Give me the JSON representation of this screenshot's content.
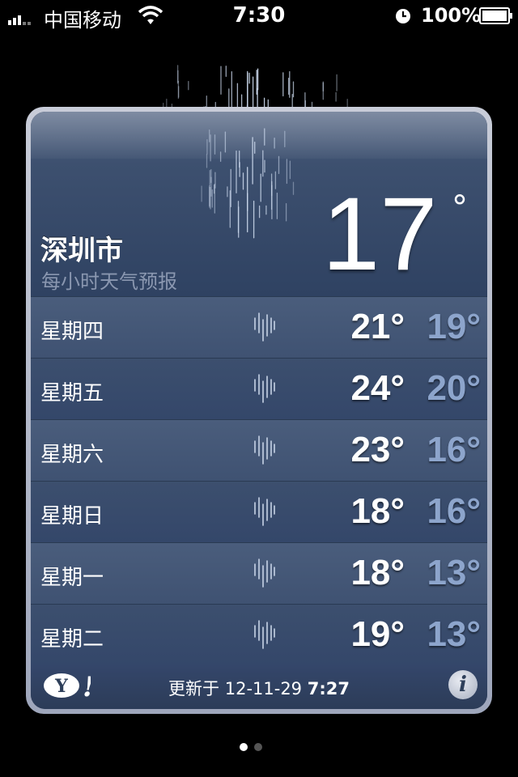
{
  "status_bar": {
    "carrier": "中国移动",
    "time": "7:30",
    "battery": "100%"
  },
  "weather": {
    "city": "深圳市",
    "subtitle": "每小时天气预报",
    "current_temp": "17",
    "degree_symbol": "°",
    "condition_icon": "rain-icon",
    "forecast": [
      {
        "day": "星期四",
        "high": "21°",
        "low": "19°",
        "icon": "rain-icon"
      },
      {
        "day": "星期五",
        "high": "24°",
        "low": "20°",
        "icon": "rain-icon"
      },
      {
        "day": "星期六",
        "high": "23°",
        "low": "16°",
        "icon": "rain-icon"
      },
      {
        "day": "星期日",
        "high": "18°",
        "low": "16°",
        "icon": "rain-icon"
      },
      {
        "day": "星期一",
        "high": "18°",
        "low": "13°",
        "icon": "rain-icon"
      },
      {
        "day": "星期二",
        "high": "19°",
        "low": "13°",
        "icon": "rain-icon"
      }
    ]
  },
  "footer": {
    "updated_label": "更新于",
    "updated_date": "12-11-29",
    "updated_time": "7:27",
    "info_label": "i"
  },
  "page_indicator": {
    "count": 2,
    "active": 0
  },
  "colors": {
    "card_bg": "#2e3f5a",
    "low_temp": "#8da5cc",
    "subtitle": "#8a97b0"
  }
}
